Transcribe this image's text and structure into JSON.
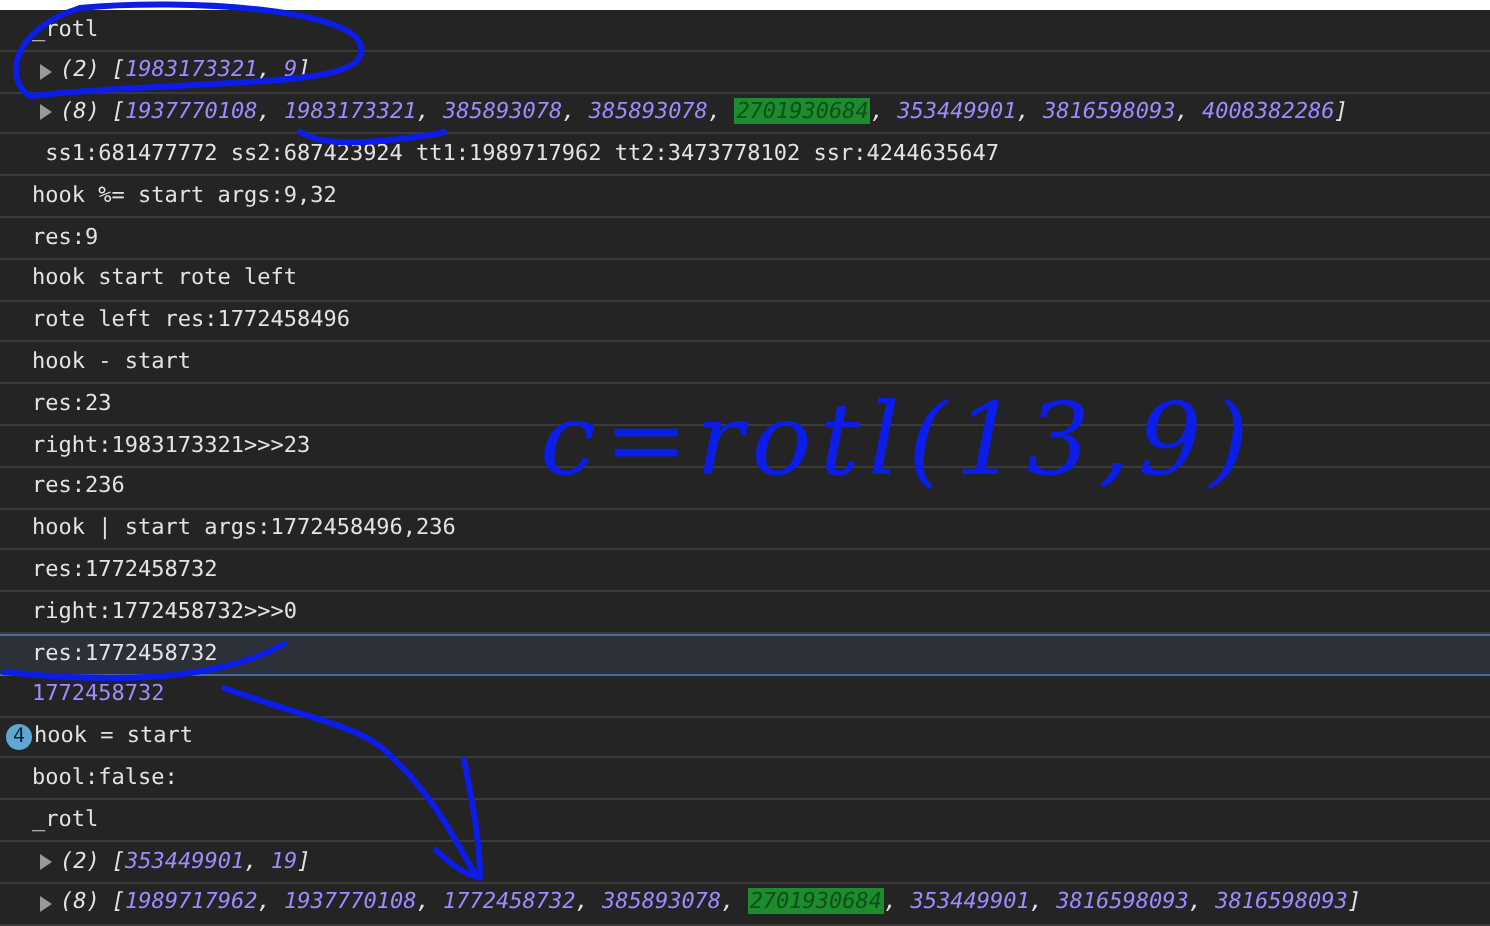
{
  "console_rows": [
    {
      "kind": "log",
      "text": "_rotl",
      "selected": false
    },
    {
      "kind": "array",
      "count": "(2)",
      "items": [
        {
          "value": "1983173321",
          "highlighted": false
        },
        {
          "value": "9",
          "highlighted": false
        }
      ],
      "selected": false
    },
    {
      "kind": "array",
      "count": "(8)",
      "items": [
        {
          "value": "1937770108",
          "highlighted": false
        },
        {
          "value": "1983173321",
          "highlighted": false
        },
        {
          "value": "385893078",
          "highlighted": false
        },
        {
          "value": "385893078",
          "highlighted": false
        },
        {
          "value": "2701930684",
          "highlighted": true
        },
        {
          "value": "353449901",
          "highlighted": false
        },
        {
          "value": "3816598093",
          "highlighted": false
        },
        {
          "value": "4008382286",
          "highlighted": false
        }
      ],
      "selected": false
    },
    {
      "kind": "log",
      "text": " ss1:681477772 ss2:687423924 tt1:1989717962 tt2:3473778102 ssr:4244635647",
      "selected": false
    },
    {
      "kind": "log",
      "text": "hook %= start args:9,32",
      "selected": false
    },
    {
      "kind": "log",
      "text": "res:9",
      "selected": false
    },
    {
      "kind": "log",
      "text": "hook start rote left",
      "selected": false
    },
    {
      "kind": "log",
      "text": "rote left res:1772458496",
      "selected": false
    },
    {
      "kind": "log",
      "text": "hook - start",
      "selected": false
    },
    {
      "kind": "log",
      "text": "res:23",
      "selected": false
    },
    {
      "kind": "log",
      "text": "right:1983173321>>>23",
      "selected": false
    },
    {
      "kind": "log",
      "text": "res:236",
      "selected": false
    },
    {
      "kind": "log",
      "text": "hook | start args:1772458496,236",
      "selected": false
    },
    {
      "kind": "log",
      "text": "res:1772458732",
      "selected": false
    },
    {
      "kind": "log",
      "text": "right:1772458732>>>0",
      "selected": false
    },
    {
      "kind": "log",
      "text": "res:1772458732",
      "selected": true
    },
    {
      "kind": "result",
      "text": "1772458732",
      "selected": false
    },
    {
      "kind": "log",
      "text": "hook = start",
      "repeat": "4",
      "selected": false
    },
    {
      "kind": "log",
      "text": "bool:false:",
      "selected": false
    },
    {
      "kind": "log",
      "text": "_rotl",
      "selected": false
    },
    {
      "kind": "array",
      "count": "(2)",
      "items": [
        {
          "value": "353449901",
          "highlighted": false
        },
        {
          "value": "19",
          "highlighted": false
        }
      ],
      "selected": false
    },
    {
      "kind": "array",
      "count": "(8)",
      "items": [
        {
          "value": "1989717962",
          "highlighted": false
        },
        {
          "value": "1937770108",
          "highlighted": false
        },
        {
          "value": "1772458732",
          "highlighted": false
        },
        {
          "value": "385893078",
          "highlighted": false
        },
        {
          "value": "2701930684",
          "highlighted": true
        },
        {
          "value": "353449901",
          "highlighted": false
        },
        {
          "value": "3816598093",
          "highlighted": false
        },
        {
          "value": "3816598093",
          "highlighted": false
        }
      ],
      "selected": false
    }
  ],
  "array_brackets": {
    "open": "[",
    "close": "]",
    "separator": ", "
  },
  "handwritten_note": "c=rotl(13,9)"
}
